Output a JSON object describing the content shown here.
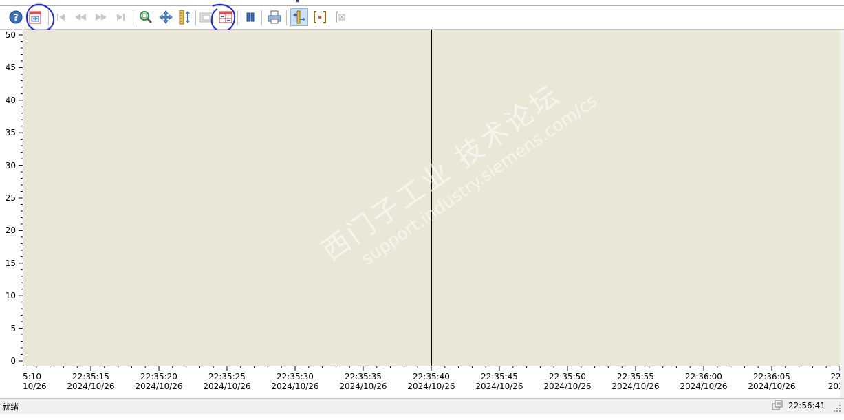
{
  "toolbar": {
    "buttons": [
      {
        "id": "help",
        "icon": "help-icon"
      },
      {
        "id": "configure",
        "icon": "configure-dialog-icon"
      },
      {
        "id": "first",
        "icon": "first-record-icon"
      },
      {
        "id": "prev",
        "icon": "previous-record-icon"
      },
      {
        "id": "next",
        "icon": "next-record-icon"
      },
      {
        "id": "last",
        "icon": "last-record-icon"
      },
      {
        "id": "zoom-area",
        "icon": "zoom-area-icon"
      },
      {
        "id": "move",
        "icon": "move-axes-icon"
      },
      {
        "id": "zoom-value-axis",
        "icon": "zoom-value-axis-icon"
      },
      {
        "id": "original-view",
        "icon": "original-view-icon"
      },
      {
        "id": "select-trends",
        "icon": "select-trends-icon"
      },
      {
        "id": "stop",
        "icon": "stop-icon"
      },
      {
        "id": "print",
        "icon": "print-icon"
      },
      {
        "id": "ruler",
        "icon": "ruler-icon"
      },
      {
        "id": "statistics-area",
        "icon": "statistics-area-icon"
      },
      {
        "id": "statistics",
        "icon": "statistics-icon"
      }
    ],
    "highlight_color": "#1a2bd8"
  },
  "trend": {
    "background": "#ebe7d7",
    "y_ticks": [
      "50",
      "45",
      "40",
      "35",
      "30",
      "25",
      "20",
      "15",
      "10",
      "5",
      "0"
    ],
    "x_labels": [
      {
        "time": "5:10",
        "date": "10/26"
      },
      {
        "time": "22:35:15",
        "date": "2024/10/26"
      },
      {
        "time": "22:35:20",
        "date": "2024/10/26"
      },
      {
        "time": "22:35:25",
        "date": "2024/10/26"
      },
      {
        "time": "22:35:30",
        "date": "2024/10/26"
      },
      {
        "time": "22:35:35",
        "date": "2024/10/26"
      },
      {
        "time": "22:35:40",
        "date": "2024/10/26"
      },
      {
        "time": "22:35:45",
        "date": "2024/10/26"
      },
      {
        "time": "22:35:50",
        "date": "2024/10/26"
      },
      {
        "time": "22:35:55",
        "date": "2024/10/26"
      },
      {
        "time": "22:36:00",
        "date": "2024/10/26"
      },
      {
        "time": "22:36:05",
        "date": "2024/10/26"
      },
      {
        "time": "22:3",
        "date": "2024/"
      }
    ]
  },
  "watermark": {
    "line1": "西门子工业 技术论坛",
    "line2": "support.industry.siemens.com/cs"
  },
  "statusbar": {
    "text": "就绪",
    "time": "22:56:41"
  }
}
